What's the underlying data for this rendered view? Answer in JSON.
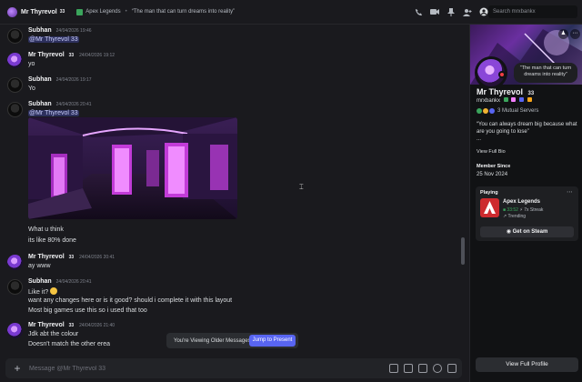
{
  "header": {
    "name": "Mr Thyrevol",
    "badge": "33",
    "activity_game": "Apex Legends",
    "separator": "•",
    "quote": "“The man that can turn dreams into reality”",
    "search_placeholder": "Search mrxbankx"
  },
  "messages": [
    {
      "author": "Subhan",
      "time": "24/04/2026 19:46",
      "lines": [
        "@Mr Thyrevol 33"
      ]
    },
    {
      "author": "Mr Thyrevol",
      "badge": "33",
      "time": "24/04/2026 19:12",
      "lines": [
        "yo"
      ]
    },
    {
      "author": "Subhan",
      "time": "24/04/2026 19:17",
      "lines": [
        "Yo"
      ]
    },
    {
      "author": "Subhan",
      "time": "24/04/2026 20:41",
      "lines": [
        "@Mr Thyrevol 33",
        "What u think",
        "its like 80% done"
      ]
    },
    {
      "author": "Mr Thyrevol",
      "badge": "33",
      "time": "24/04/2026 20:41",
      "lines": [
        "ay www"
      ]
    },
    {
      "author": "Subhan",
      "time": "24/04/2026 20:41",
      "lines": [
        "Like it?",
        "want any changes here or is it good? should i complete it with this layout",
        "Most big games use this so i used that too"
      ]
    },
    {
      "author": "Mr Thyrevol",
      "badge": "33",
      "time": "24/04/2026 21:40",
      "lines": [
        "Jdk abt the colour",
        "Doesn't match the other erea"
      ]
    }
  ],
  "jump": {
    "text": "You're Viewing Older Messages",
    "button": "Jump to Present"
  },
  "composer": {
    "placeholder": "Message @Mr Thyrevol 33"
  },
  "profile": {
    "name": "Mr Thyrevol",
    "badge": "33",
    "username": "mrxbankx",
    "bubble": "“The man that can turn dreams into reality”",
    "mutual": "3 Mutual Servers",
    "bio": "“You can always dream big because what are you going to lose”",
    "bio_more": "...",
    "view_bio": "View Full Bio",
    "member_since_label": "Member Since",
    "member_since": "25 Nov 2024",
    "playing_label": "Playing",
    "game": "Apex Legends",
    "game_time": "33:52",
    "game_streak": "7x Streak",
    "game_trend": "Trending",
    "steam_button": "Get on Steam",
    "full_profile": "View Full Profile"
  },
  "colors": {
    "accent": "#5865f2",
    "online_status": "#f23f43",
    "apex": "#cd2b2f"
  }
}
